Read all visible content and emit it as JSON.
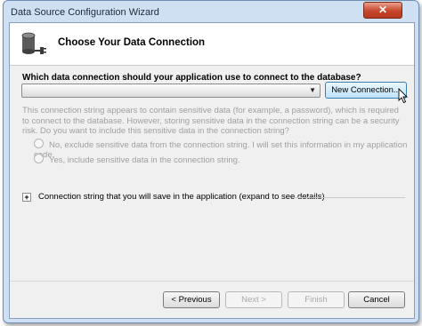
{
  "window": {
    "title": "Data Source Configuration Wizard",
    "close_glyph": "✕"
  },
  "header": {
    "title": "Choose Your Data Connection",
    "icon": "database-plug-icon"
  },
  "question": "Which data connection should your application use to connect to the database?",
  "combo": {
    "value": ""
  },
  "new_connection_label": "New Connection...",
  "description": "This connection string appears to contain sensitive data (for example, a password), which is required to connect to the database. However, storing sensitive data in the connection string can be a security risk. Do you want to include this sensitive data in the connection string?",
  "options": [
    {
      "label": "No, exclude sensitive data from the connection string. I will set this information in my application code."
    },
    {
      "label": "Yes, include sensitive data in the connection string."
    }
  ],
  "expand_label": "Connection string that you will save in the application (expand to see details)",
  "buttons": {
    "previous": "< Previous",
    "next": "Next >",
    "finish": "Finish",
    "cancel": "Cancel"
  }
}
